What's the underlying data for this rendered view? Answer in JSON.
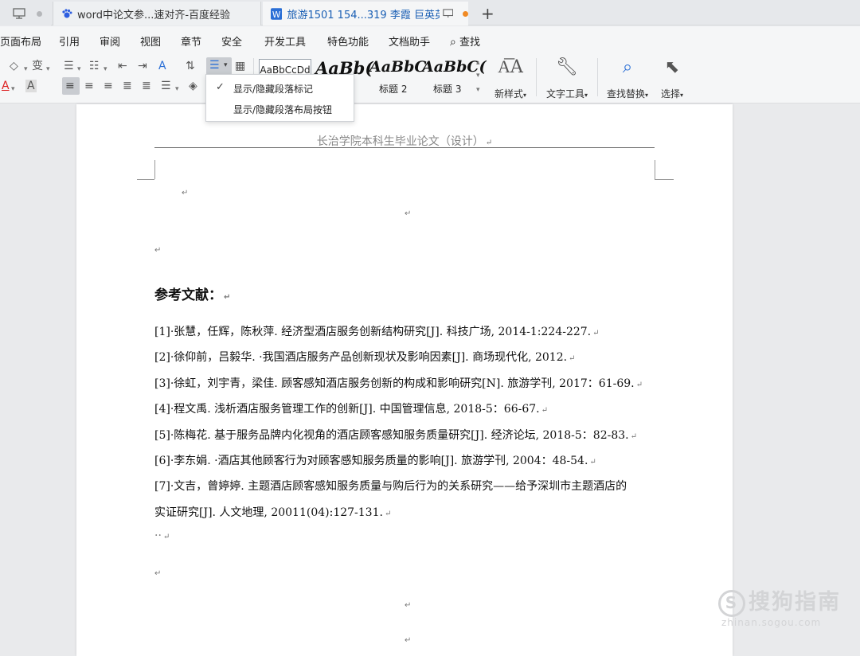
{
  "tabs": [
    {
      "label": ""
    },
    {
      "label": "word中论文参...速对齐-百度经验"
    },
    {
      "label": "旅游1501 154...319 李霞 巨英英"
    }
  ],
  "menu": [
    "页面布局",
    "引用",
    "审阅",
    "视图",
    "章节",
    "安全",
    "开发工具",
    "特色功能",
    "文档助手",
    "查找"
  ],
  "toolbar": {
    "style_normal": "AaBbCcDd",
    "style_previews": [
      "AaBb(",
      "AaBbC",
      "AaBbC("
    ],
    "style_labels": [
      "标题 2",
      "标题 3"
    ],
    "new_style": "新样式",
    "text_tools": "文字工具",
    "find_replace": "查找替换",
    "select": "选择"
  },
  "dropdown": {
    "items": [
      "显示/隐藏段落标记",
      "显示/隐藏段落布局按钮"
    ],
    "checked_index": 0
  },
  "document": {
    "header": "长治学院本科生毕业论文（设计）",
    "heading": "参考文献：",
    "references": [
      "[1]·张慧，任辉，陈秋萍. 经济型酒店服务创新结构研究[J]. 科技广场, 2014-1:224-227.",
      "[2]·徐仰前，吕毅华. ·我国酒店服务产品创新现状及影响因素[J]. 商场现代化, 2012.",
      "[3]·徐虹，刘宇青，梁佳. 顾客感知酒店服务创新的构成和影响研究[N]. 旅游学刊, 2017：61-69.",
      "[4]·程文禹. 浅析酒店服务管理工作的创新[J]. 中国管理信息, 2018-5：66-67.",
      "[5]·陈梅花. 基于服务品牌内化视角的酒店顾客感知服务质量研究[J]. 经济论坛, 2018-5：82-83.",
      "[6]·李东娟. ·酒店其他顾客行为对顾客感知服务质量的影响[J]. 旅游学刊, 2004：48-54.",
      "[7]·文吉，曾婷婷. 主题酒店顾客感知服务质量与购后行为的关系研究——给予深圳市主题酒店的",
      "实证研究[J]. 人文地理, 20011(04):127-131."
    ],
    "trailing": "··"
  },
  "watermark": {
    "main": "搜狗指南",
    "sub": "zhinan.sogou.com"
  },
  "colors": {
    "accent": "#1a5fb4",
    "unsaved_dot": "#f08a24",
    "toolbar_bg": "#f5f6f7"
  }
}
